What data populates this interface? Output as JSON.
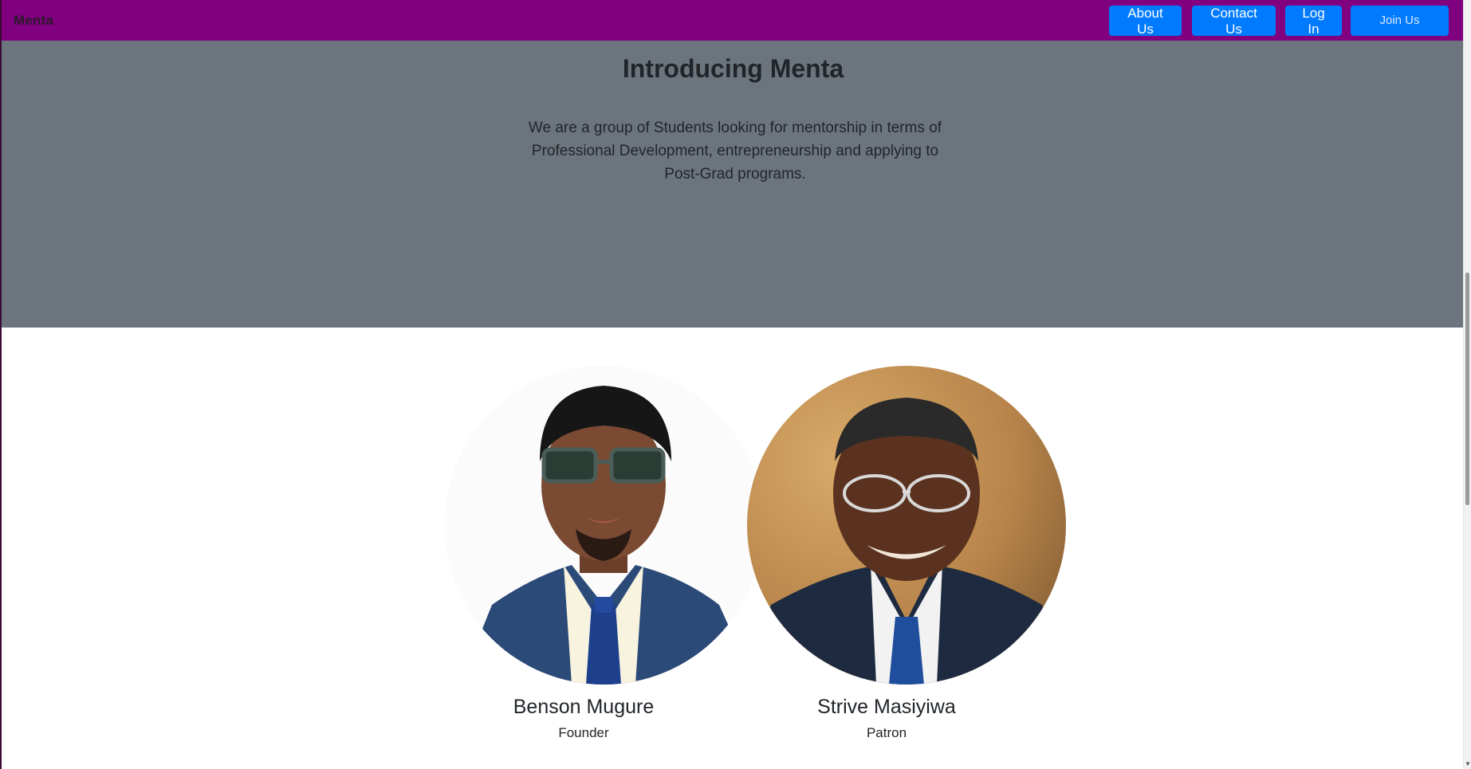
{
  "navbar": {
    "brand": "Menta",
    "buttons": {
      "about": "About Us",
      "contact": "Contact Us",
      "login": "Log In",
      "join": "Join Us"
    }
  },
  "hero": {
    "title": "Introducing Menta",
    "description": "We are a group of Students looking for mentorship in terms of Professional Development, entrepreneurship and applying to Post-Grad programs."
  },
  "team": [
    {
      "name": "Benson Mugure",
      "role": "Founder"
    },
    {
      "name": "Strive Masiyiwa",
      "role": "Patron"
    }
  ],
  "colors": {
    "navbar_bg": "#800080",
    "hero_bg": "#6c757d",
    "button_bg": "#007bff"
  }
}
